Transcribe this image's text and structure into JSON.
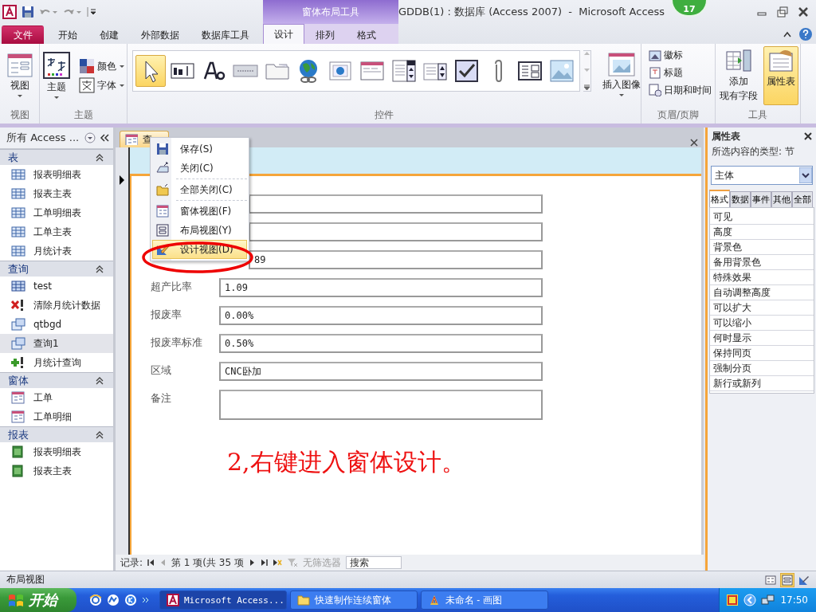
{
  "title_bar": {
    "context_tab_group": "窗体布局工具",
    "title": "GDDB(1) : 数据库 (Access 2007)  -  Microsoft Access",
    "badge": "17"
  },
  "ribbon_tabs": [
    {
      "label": "文件",
      "kind": "file",
      "selected": false
    },
    {
      "label": "开始",
      "kind": "normal",
      "selected": false
    },
    {
      "label": "创建",
      "kind": "normal",
      "selected": false
    },
    {
      "label": "外部数据",
      "kind": "normal",
      "selected": false
    },
    {
      "label": "数据库工具",
      "kind": "normal",
      "selected": false
    },
    {
      "label": "设计",
      "kind": "context",
      "selected": true
    },
    {
      "label": "排列",
      "kind": "context",
      "selected": false
    },
    {
      "label": "格式",
      "kind": "context",
      "selected": false
    }
  ],
  "ribbon": {
    "groups": [
      {
        "kind": "view",
        "label": "视图",
        "button": "视图"
      },
      {
        "kind": "theme",
        "label": "主题",
        "button": "主题",
        "options": [
          "颜色",
          "字体"
        ]
      },
      {
        "kind": "controls",
        "label": "控件",
        "button": "插入图像",
        "controls": [
          {
            "kind": "pointer",
            "selected": true
          },
          {
            "kind": "textbox",
            "selected": false
          },
          {
            "kind": "label",
            "selected": false
          },
          {
            "kind": "button",
            "selected": false
          },
          {
            "kind": "tab",
            "selected": false
          },
          {
            "kind": "hyperlink",
            "selected": false
          },
          {
            "kind": "browser",
            "selected": false
          },
          {
            "kind": "navigation",
            "selected": false
          },
          {
            "kind": "combo",
            "selected": false
          },
          {
            "kind": "list",
            "selected": false
          },
          {
            "kind": "checkbox",
            "selected": false
          },
          {
            "kind": "attachment",
            "selected": false
          },
          {
            "kind": "subform",
            "selected": false
          },
          {
            "kind": "image",
            "selected": false
          }
        ]
      },
      {
        "kind": "header_footer",
        "label": "页眉/页脚",
        "items": [
          {
            "label": "徽标",
            "kind": "logo"
          },
          {
            "label": "标题",
            "kind": "title"
          },
          {
            "label": "日期和时间",
            "kind": "datetime"
          }
        ]
      },
      {
        "kind": "tools",
        "label": "工具",
        "buttons": [
          {
            "lines": [
              "添加",
              "现有字段"
            ],
            "kind": "fields",
            "selected": false
          },
          {
            "lines": [
              "属性表"
            ],
            "kind": "sheet",
            "selected": true
          }
        ]
      }
    ]
  },
  "nav_pane": {
    "title": "所有 Access ...",
    "groups": [
      {
        "label": "表",
        "expanded": true,
        "items": [
          {
            "label": "报表明细表",
            "kind": "table",
            "selected": false
          },
          {
            "label": "报表主表",
            "kind": "table",
            "selected": false
          },
          {
            "label": "工单明细表",
            "kind": "table",
            "selected": false
          },
          {
            "label": "工单主表",
            "kind": "table",
            "selected": false
          },
          {
            "label": "月统计表",
            "kind": "table",
            "selected": false
          }
        ]
      },
      {
        "label": "查询",
        "expanded": true,
        "items": [
          {
            "label": "test",
            "kind": "select_query",
            "selected": false
          },
          {
            "label": "清除月统计数据",
            "kind": "delete_query",
            "selected": false
          },
          {
            "label": "qtbgd",
            "kind": "maketable_query",
            "selected": false
          },
          {
            "label": "查询1",
            "kind": "maketable_query",
            "selected": true
          },
          {
            "label": "月统计查询",
            "kind": "append_query",
            "selected": false
          }
        ]
      },
      {
        "label": "窗体",
        "expanded": true,
        "items": [
          {
            "label": "工单",
            "kind": "form",
            "selected": false
          },
          {
            "label": "工单明细",
            "kind": "form",
            "selected": false
          }
        ]
      },
      {
        "label": "报表",
        "expanded": true,
        "items": [
          {
            "label": "报表明细表",
            "kind": "report",
            "selected": false
          },
          {
            "label": "报表主表",
            "kind": "report",
            "selected": false
          }
        ]
      }
    ]
  },
  "document": {
    "tab": "查",
    "fields": [
      {
        "kind": "covered"
      },
      {
        "kind": "covered"
      },
      {
        "kind": "covered",
        "value": "89"
      },
      {
        "kind": "text",
        "label": "超产比率",
        "value": "1.09"
      },
      {
        "kind": "text",
        "label": "报废率",
        "value": "0.00%"
      },
      {
        "kind": "text",
        "label": "报废率标准",
        "value": "0.50%"
      },
      {
        "kind": "text",
        "label": "区域",
        "value": "CNC卧加"
      },
      {
        "kind": "memo",
        "label": "备注"
      }
    ],
    "annotation": "2,右键进入窗体设计。",
    "record_nav": {
      "label": "记录:",
      "position": "第 1 项(共 35 项",
      "filter": "无筛选器",
      "search_placeholder": "搜索"
    }
  },
  "context_menu": {
    "items": [
      {
        "label": "保存(S)",
        "kind": "save",
        "selected": false,
        "separator_after": false
      },
      {
        "label": "关闭(C)",
        "kind": "close",
        "selected": false,
        "separator_after": true
      },
      {
        "label": "全部关闭(C)",
        "kind": "close_all",
        "selected": false,
        "separator_after": true
      },
      {
        "label": "窗体视图(F)",
        "kind": "form_view",
        "selected": false,
        "separator_after": false
      },
      {
        "label": "布局视图(Y)",
        "kind": "layout_view",
        "selected": false,
        "separator_after": false
      },
      {
        "label": "设计视图(D)",
        "kind": "design_view",
        "selected": true,
        "separator_after": false
      }
    ]
  },
  "property_sheet": {
    "title": "属性表",
    "selection_type": "所选内容的类型: 节",
    "section": "主体",
    "tabs": [
      {
        "label": "格式",
        "selected": true
      },
      {
        "label": "数据",
        "selected": false
      },
      {
        "label": "事件",
        "selected": false
      },
      {
        "label": "其他",
        "selected": false
      },
      {
        "label": "全部",
        "selected": false
      }
    ],
    "properties": [
      "可见",
      "高度",
      "背景色",
      "备用背景色",
      "特殊效果",
      "自动调整高度",
      "可以扩大",
      "可以缩小",
      "何时显示",
      "保持同页",
      "强制分页",
      "新行或新列"
    ]
  },
  "status_bar": {
    "text": "布局视图",
    "views": [
      {
        "kind": "form",
        "selected": false
      },
      {
        "kind": "layout",
        "selected": true
      },
      {
        "kind": "design",
        "selected": false
      }
    ]
  },
  "taskbar": {
    "start": "开始",
    "tasks": [
      {
        "label": "Microsoft Access...",
        "kind": "access",
        "selected": true
      },
      {
        "label": "快速制作连续窗体",
        "kind": "folder",
        "selected": false
      },
      {
        "label": "未命名 - 画图",
        "kind": "paint",
        "selected": false
      }
    ],
    "clock": "17:50"
  }
}
